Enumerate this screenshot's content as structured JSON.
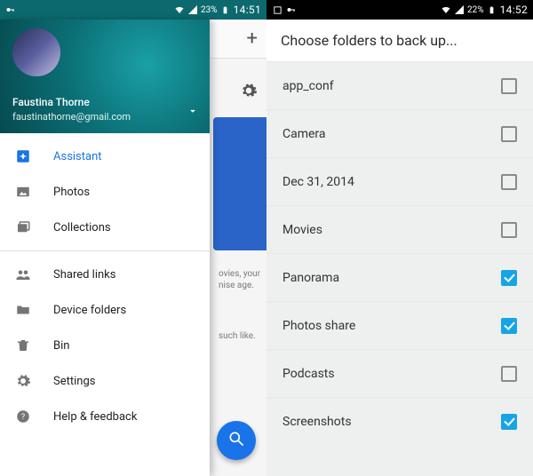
{
  "left": {
    "statusbar": {
      "key_icon": "key-icon",
      "wifi_icon": "wifi-icon",
      "signal_icon": "signal-icon",
      "battery_pct": "23%",
      "battery_icon": "battery-icon",
      "time": "14:51"
    },
    "drawer": {
      "account": {
        "name": "Faustina Thorne",
        "email": "faustinathorne@gmail.com"
      },
      "items": [
        {
          "label": "Assistant",
          "icon": "assistant-icon",
          "active": true
        },
        {
          "label": "Photos",
          "icon": "photos-icon",
          "active": false
        },
        {
          "label": "Collections",
          "icon": "collections-icon",
          "active": false
        }
      ],
      "items2": [
        {
          "label": "Shared links",
          "icon": "people-icon"
        },
        {
          "label": "Device folders",
          "icon": "folder-icon"
        },
        {
          "label": "Bin",
          "icon": "trash-icon"
        },
        {
          "label": "Settings",
          "icon": "gear-icon"
        },
        {
          "label": "Help & feedback",
          "icon": "help-icon"
        }
      ]
    },
    "under": {
      "plus": "+",
      "text1": "ovies, your nise age.",
      "text2": "such like.",
      "fab_icon": "search-icon"
    }
  },
  "right": {
    "statusbar": {
      "square_icon": "square-icon",
      "key_icon": "key-icon",
      "wifi_icon": "wifi-icon",
      "signal_icon": "signal-icon",
      "battery_pct": "22%",
      "battery_icon": "battery-icon",
      "time": "14:52"
    },
    "title": "Choose folders to back up...",
    "folders": [
      {
        "label": "app_conf",
        "checked": false
      },
      {
        "label": "Camera",
        "checked": false
      },
      {
        "label": "Dec 31, 2014",
        "checked": false
      },
      {
        "label": "Movies",
        "checked": false
      },
      {
        "label": "Panorama",
        "checked": true
      },
      {
        "label": "Photos share",
        "checked": true
      },
      {
        "label": "Podcasts",
        "checked": false
      },
      {
        "label": "Screenshots",
        "checked": true
      }
    ]
  }
}
